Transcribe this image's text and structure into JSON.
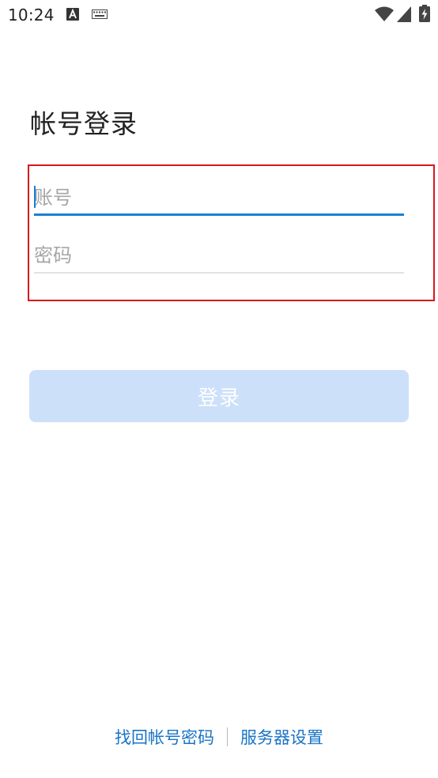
{
  "status_bar": {
    "time": "10:24",
    "icons": [
      "a-notification-icon",
      "keyboard-icon",
      "wifi-icon",
      "signal-icon",
      "battery-charging-icon"
    ]
  },
  "page": {
    "title": "帐号登录"
  },
  "form": {
    "account": {
      "placeholder": "账号",
      "value": ""
    },
    "password": {
      "placeholder": "密码",
      "value": ""
    },
    "login_label": "登录"
  },
  "footer": {
    "recover_label": "找回帐号密码",
    "server_label": "服务器设置"
  },
  "colors": {
    "accent": "#1a7fd6",
    "link": "#1a74c6",
    "button_disabled": "#cce0fa",
    "highlight_border": "#d9161e"
  }
}
